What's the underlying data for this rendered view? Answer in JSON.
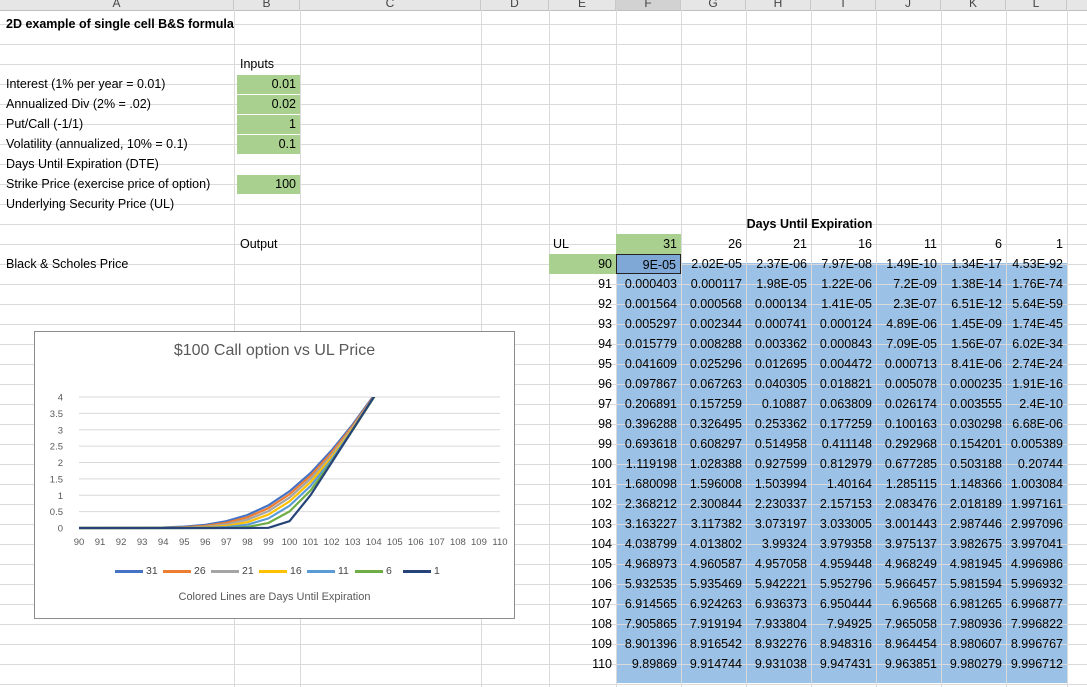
{
  "columns": [
    "A",
    "B",
    "C",
    "D",
    "E",
    "F",
    "G",
    "H",
    "I",
    "J",
    "K",
    "L"
  ],
  "sheet": {
    "title": "2D example of single cell B&S formula",
    "inputs_header": "Inputs",
    "inputs": [
      {
        "label": "Interest  (1% per year = 0.01)",
        "value": "0.01"
      },
      {
        "label": "Annualized Div (2% = .02)",
        "value": "0.02"
      },
      {
        "label": "Put/Call (-1/1)",
        "value": "1"
      },
      {
        "label": "Volatility (annualized, 10% = 0.1)",
        "value": "0.1"
      },
      {
        "label": "Days Until Expiration (DTE)",
        "value": ""
      },
      {
        "label": "Strike Price (exercise price of option)",
        "value": "100"
      },
      {
        "label": "Underlying Security Price (UL)",
        "value": ""
      }
    ],
    "output_header": "Output",
    "output_label": "Black & Scholes Price"
  },
  "table": {
    "title": "Days Until Expiration",
    "ul_label": "UL",
    "dte": [
      "31",
      "26",
      "21",
      "16",
      "11",
      "6",
      "1"
    ],
    "rows": [
      {
        "ul": "90",
        "v": [
          "9E-05",
          "2.02E-05",
          "2.37E-06",
          "7.97E-08",
          "1.49E-10",
          "1.34E-17",
          "4.53E-92"
        ]
      },
      {
        "ul": "91",
        "v": [
          "0.000403",
          "0.000117",
          "1.98E-05",
          "1.22E-06",
          "7.2E-09",
          "1.38E-14",
          "1.76E-74"
        ]
      },
      {
        "ul": "92",
        "v": [
          "0.001564",
          "0.000568",
          "0.000134",
          "1.41E-05",
          "2.3E-07",
          "6.51E-12",
          "5.64E-59"
        ]
      },
      {
        "ul": "93",
        "v": [
          "0.005297",
          "0.002344",
          "0.000741",
          "0.000124",
          "4.89E-06",
          "1.45E-09",
          "1.74E-45"
        ]
      },
      {
        "ul": "94",
        "v": [
          "0.015779",
          "0.008288",
          "0.003362",
          "0.000843",
          "7.09E-05",
          "1.56E-07",
          "6.02E-34"
        ]
      },
      {
        "ul": "95",
        "v": [
          "0.041609",
          "0.025296",
          "0.012695",
          "0.004472",
          "0.000713",
          "8.41E-06",
          "2.74E-24"
        ]
      },
      {
        "ul": "96",
        "v": [
          "0.097867",
          "0.067263",
          "0.040305",
          "0.018821",
          "0.005078",
          "0.000235",
          "1.91E-16"
        ]
      },
      {
        "ul": "97",
        "v": [
          "0.206891",
          "0.157259",
          "0.10887",
          "0.063809",
          "0.026174",
          "0.003555",
          "2.4E-10"
        ]
      },
      {
        "ul": "98",
        "v": [
          "0.396288",
          "0.326495",
          "0.253362",
          "0.177259",
          "0.100163",
          "0.030298",
          "6.68E-06"
        ]
      },
      {
        "ul": "99",
        "v": [
          "0.693618",
          "0.608297",
          "0.514958",
          "0.411148",
          "0.292968",
          "0.154201",
          "0.005389"
        ]
      },
      {
        "ul": "100",
        "v": [
          "1.119198",
          "1.028388",
          "0.927599",
          "0.812979",
          "0.677285",
          "0.503188",
          "0.20744"
        ]
      },
      {
        "ul": "101",
        "v": [
          "1.680098",
          "1.596008",
          "1.503994",
          "1.40164",
          "1.285115",
          "1.148366",
          "1.003084"
        ]
      },
      {
        "ul": "102",
        "v": [
          "2.368212",
          "2.300844",
          "2.230337",
          "2.157153",
          "2.083476",
          "2.018189",
          "1.997161"
        ]
      },
      {
        "ul": "103",
        "v": [
          "3.163227",
          "3.117382",
          "3.073197",
          "3.033005",
          "3.001443",
          "2.987446",
          "2.997096"
        ]
      },
      {
        "ul": "104",
        "v": [
          "4.038799",
          "4.013802",
          "3.99324",
          "3.979358",
          "3.975137",
          "3.982675",
          "3.997041"
        ]
      },
      {
        "ul": "105",
        "v": [
          "4.968973",
          "4.960587",
          "4.957058",
          "4.959448",
          "4.968249",
          "4.981945",
          "4.996986"
        ]
      },
      {
        "ul": "106",
        "v": [
          "5.932535",
          "5.935469",
          "5.942221",
          "5.952796",
          "5.966457",
          "5.981594",
          "5.996932"
        ]
      },
      {
        "ul": "107",
        "v": [
          "6.914565",
          "6.924263",
          "6.936373",
          "6.950444",
          "6.96568",
          "6.981265",
          "6.996877"
        ]
      },
      {
        "ul": "108",
        "v": [
          "7.905865",
          "7.919194",
          "7.933804",
          "7.94925",
          "7.965058",
          "7.980936",
          "7.996822"
        ]
      },
      {
        "ul": "109",
        "v": [
          "8.901396",
          "8.916542",
          "8.932276",
          "8.948316",
          "8.964454",
          "8.980607",
          "8.996767"
        ]
      },
      {
        "ul": "110",
        "v": [
          "9.89869",
          "9.914744",
          "9.931038",
          "9.947431",
          "9.963851",
          "9.980279",
          "9.996712"
        ]
      }
    ]
  },
  "chart_data": {
    "type": "line",
    "title": "$100 Call option vs UL Price",
    "subtitle": "Colored Lines are Days Until Expiration",
    "x": [
      90,
      91,
      92,
      93,
      94,
      95,
      96,
      97,
      98,
      99,
      100,
      101,
      102,
      103,
      104,
      105,
      106,
      107,
      108,
      109,
      110
    ],
    "yticks": [
      "0",
      "0.5",
      "1",
      "1.5",
      "2",
      "2.5",
      "3",
      "3.5",
      "4"
    ],
    "ylim": [
      0,
      4
    ],
    "xlim": [
      90,
      110
    ],
    "legend_position": "bottom",
    "grid": true,
    "series": [
      {
        "name": "31",
        "color": "#4472c4",
        "values": [
          9e-05,
          0.000403,
          0.001564,
          0.005297,
          0.015779,
          0.041609,
          0.097867,
          0.206891,
          0.396288,
          0.693618,
          1.119198,
          1.680098,
          2.368212,
          3.163227,
          4.038799,
          4.968973,
          5.932535,
          6.914565,
          7.905865,
          8.901396,
          9.89869
        ]
      },
      {
        "name": "26",
        "color": "#ed7d31",
        "values": [
          2.02e-05,
          0.000117,
          0.000568,
          0.002344,
          0.008288,
          0.025296,
          0.067263,
          0.157259,
          0.326495,
          0.608297,
          1.028388,
          1.596008,
          2.300844,
          3.117382,
          4.013802,
          4.960587,
          5.935469,
          6.924263,
          7.919194,
          8.916542,
          9.914744
        ]
      },
      {
        "name": "21",
        "color": "#a5a5a5",
        "values": [
          2.37e-06,
          1.98e-05,
          0.000134,
          0.000741,
          0.003362,
          0.012695,
          0.040305,
          0.10887,
          0.253362,
          0.514958,
          0.927599,
          1.503994,
          2.230337,
          3.073197,
          3.99324,
          4.957058,
          5.942221,
          6.936373,
          7.933804,
          8.932276,
          9.931038
        ]
      },
      {
        "name": "16",
        "color": "#ffc000",
        "values": [
          7.97e-08,
          1.22e-06,
          1.41e-05,
          0.000124,
          0.000843,
          0.004472,
          0.018821,
          0.063809,
          0.177259,
          0.411148,
          0.812979,
          1.40164,
          2.157153,
          3.033005,
          3.979358,
          4.959448,
          5.952796,
          6.950444,
          7.94925,
          8.948316,
          9.947431
        ]
      },
      {
        "name": "11",
        "color": "#5b9bd5",
        "values": [
          0,
          7.2e-09,
          2.3e-07,
          4.89e-06,
          7.09e-05,
          0.000713,
          0.005078,
          0.026174,
          0.100163,
          0.292968,
          0.677285,
          1.285115,
          2.083476,
          3.001443,
          3.975137,
          4.968249,
          5.966457,
          6.96568,
          7.965058,
          8.964454,
          9.963851
        ]
      },
      {
        "name": "6",
        "color": "#70ad47",
        "values": [
          0,
          0,
          0,
          1.45e-09,
          1.56e-07,
          8.41e-06,
          0.000235,
          0.003555,
          0.030298,
          0.154201,
          0.503188,
          1.148366,
          2.018189,
          2.987446,
          3.982675,
          4.981945,
          5.981594,
          6.981265,
          7.980936,
          8.980607,
          9.980279
        ]
      },
      {
        "name": "1",
        "color": "#264478",
        "values": [
          0,
          0,
          0,
          0,
          0,
          0,
          0,
          0,
          6.68e-06,
          0.005389,
          0.20744,
          1.003084,
          1.997161,
          2.997096,
          3.997041,
          4.996986,
          5.996932,
          6.996877,
          7.996822,
          8.996767,
          9.996712
        ]
      }
    ]
  }
}
